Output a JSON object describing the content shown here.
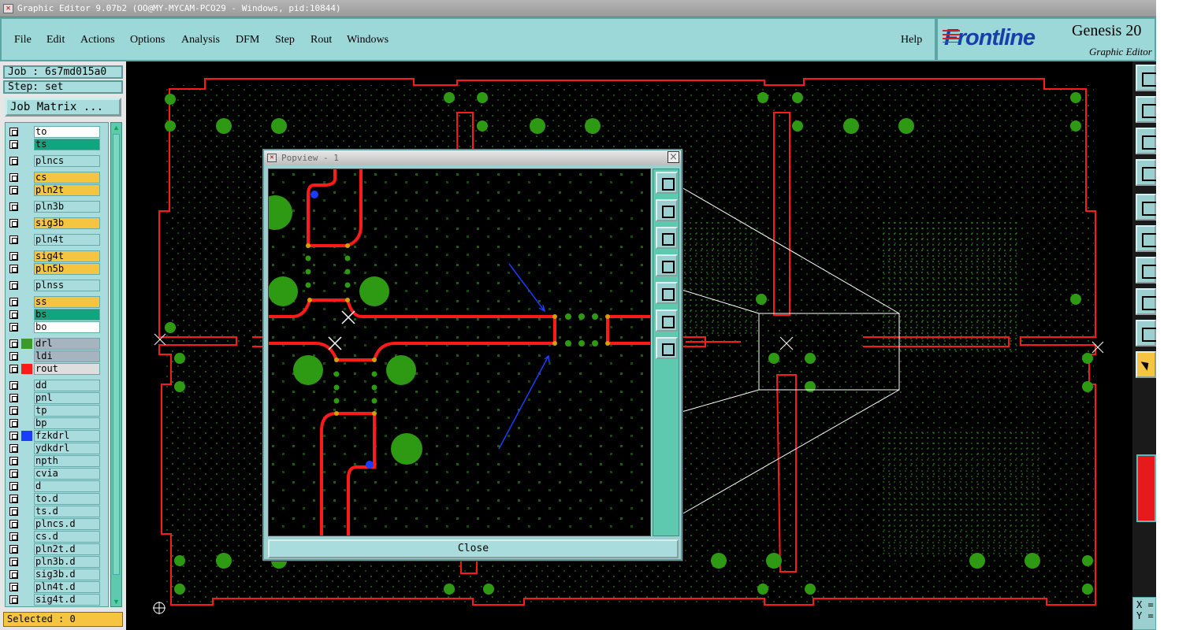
{
  "window": {
    "title": "Graphic Editor 9.07b2 (OO@MY-MYCAM-PCO29 - Windows, pid:10844)"
  },
  "menu": {
    "items": [
      {
        "label": "File"
      },
      {
        "label": "Edit"
      },
      {
        "label": "Actions"
      },
      {
        "label": "Options"
      },
      {
        "label": "Analysis"
      },
      {
        "label": "DFM"
      },
      {
        "label": "Step"
      },
      {
        "label": "Rout"
      },
      {
        "label": "Windows"
      }
    ],
    "help": "Help"
  },
  "logo": {
    "brand": "Frontline",
    "product": "Genesis 20",
    "subtitle": "Graphic Editor"
  },
  "job": {
    "job_label": "Job : 6s7md015a0",
    "step_label": "Step: set",
    "matrix_button": "Job Matrix ..."
  },
  "layers": [
    {
      "name": "to",
      "color": "#ffffff",
      "swatch": ""
    },
    {
      "name": "ts",
      "color": "#14a37f",
      "swatch": ""
    },
    {
      "name": "plncs",
      "color": "#a9dcdc",
      "swatch": ""
    },
    {
      "name": "cs",
      "color": "#f5c542",
      "swatch": ""
    },
    {
      "name": "pln2t",
      "color": "#f5c542",
      "swatch": ""
    },
    {
      "name": "pln3b",
      "color": "#a9dcdc",
      "swatch": ""
    },
    {
      "name": "sig3b",
      "color": "#f5c542",
      "swatch": ""
    },
    {
      "name": "pln4t",
      "color": "#a9dcdc",
      "swatch": ""
    },
    {
      "name": "sig4t",
      "color": "#f5c542",
      "swatch": ""
    },
    {
      "name": "pln5b",
      "color": "#f5c542",
      "swatch": ""
    },
    {
      "name": "plnss",
      "color": "#a9dcdc",
      "swatch": ""
    },
    {
      "name": "ss",
      "color": "#f5c542",
      "swatch": ""
    },
    {
      "name": "bs",
      "color": "#14a37f",
      "swatch": ""
    },
    {
      "name": "bo",
      "color": "#ffffff",
      "swatch": ""
    },
    {
      "name": "drl",
      "color": "#a5b4be",
      "swatch": "#3a9a2a"
    },
    {
      "name": "ldi",
      "color": "#a5b4be",
      "swatch": ""
    },
    {
      "name": "rout",
      "color": "#dedede",
      "swatch": "#ff1a1a"
    },
    {
      "name": "dd",
      "color": "#a9dcdc",
      "swatch": ""
    },
    {
      "name": "pnl",
      "color": "#a9dcdc",
      "swatch": ""
    },
    {
      "name": "tp",
      "color": "#a9dcdc",
      "swatch": ""
    },
    {
      "name": "bp",
      "color": "#a9dcdc",
      "swatch": ""
    },
    {
      "name": "fzkdrl",
      "color": "#a9dcdc",
      "swatch": "#1a3cff"
    },
    {
      "name": "ydkdrl",
      "color": "#a9dcdc",
      "swatch": ""
    },
    {
      "name": "npth",
      "color": "#a9dcdc",
      "swatch": ""
    },
    {
      "name": "cvia",
      "color": "#a9dcdc",
      "swatch": ""
    },
    {
      "name": "d",
      "color": "#a9dcdc",
      "swatch": ""
    },
    {
      "name": "to.d",
      "color": "#a9dcdc",
      "swatch": ""
    },
    {
      "name": "ts.d",
      "color": "#a9dcdc",
      "swatch": ""
    },
    {
      "name": "plncs.d",
      "color": "#a9dcdc",
      "swatch": ""
    },
    {
      "name": "cs.d",
      "color": "#a9dcdc",
      "swatch": ""
    },
    {
      "name": "pln2t.d",
      "color": "#a9dcdc",
      "swatch": ""
    },
    {
      "name": "pln3b.d",
      "color": "#a9dcdc",
      "swatch": ""
    },
    {
      "name": "sig3b.d",
      "color": "#a9dcdc",
      "swatch": ""
    },
    {
      "name": "pln4t.d",
      "color": "#a9dcdc",
      "swatch": ""
    },
    {
      "name": "sig4t.d",
      "color": "#a9dcdc",
      "swatch": ""
    }
  ],
  "status": {
    "selected": "Selected : 0"
  },
  "coords": {
    "x_label": "X =",
    "y_label": "Y ="
  },
  "popview": {
    "title": "Popview - 1",
    "close_button": "Close",
    "close_x": "×"
  },
  "colors": {
    "accent": "#9ccfd0",
    "rout": "#ff1a1a",
    "pads": "#2a9a10",
    "highlight": "#f5c542"
  }
}
